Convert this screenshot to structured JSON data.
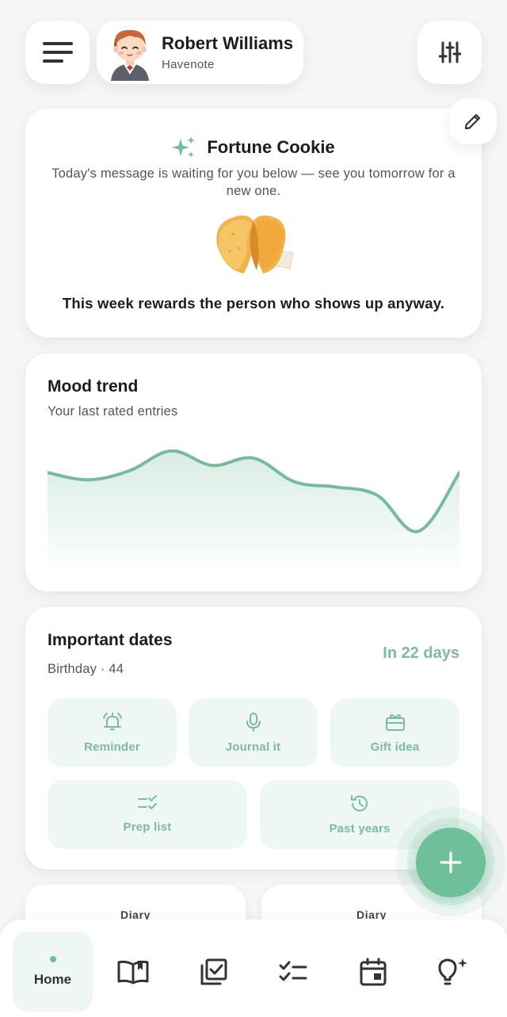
{
  "header": {
    "user_name": "Robert Williams",
    "app_name": "Havenote"
  },
  "fortune": {
    "title": "Fortune Cookie",
    "description": "Today's message is waiting for you below — see you tomorrow for a new one.",
    "message": "This week rewards the person who shows up anyway."
  },
  "mood": {
    "title": "Mood trend",
    "subtitle": "Your last rated entries"
  },
  "chart_data": {
    "type": "area",
    "title": "Mood trend",
    "subtitle": "Your last rated entries",
    "x": [
      1,
      2,
      3,
      4,
      5,
      6,
      7,
      8,
      9,
      10,
      11
    ],
    "values": [
      0.66,
      0.59,
      0.68,
      0.87,
      0.73,
      0.8,
      0.57,
      0.52,
      0.44,
      0.09,
      0.66
    ],
    "xlabel": "",
    "ylabel": "",
    "ylim": [
      0,
      1
    ],
    "grid": false,
    "line_color": "#74bc9d"
  },
  "important_dates": {
    "title": "Important dates",
    "subtitle": "Birthday · 44",
    "countdown": "In 22 days",
    "actions": [
      {
        "label": "Reminder",
        "icon": "alarm-icon"
      },
      {
        "label": "Journal it",
        "icon": "mic-icon"
      },
      {
        "label": "Gift idea",
        "icon": "gift-icon"
      },
      {
        "label": "Prep list",
        "icon": "checklist-icon"
      },
      {
        "label": "Past years",
        "icon": "history-icon"
      }
    ]
  },
  "diary_cards": [
    "Diary",
    "Diary"
  ],
  "nav": {
    "home_label": "Home",
    "items": [
      "Home",
      "journal-book-icon",
      "checkbox-icon",
      "checklist-icon",
      "calendar-icon",
      "idea-bulb-icon"
    ]
  },
  "colors": {
    "accent": "#6fbf9b",
    "accent_light": "#eef7f3",
    "accent_text": "#7dbba1",
    "background": "#f6f6f6"
  }
}
